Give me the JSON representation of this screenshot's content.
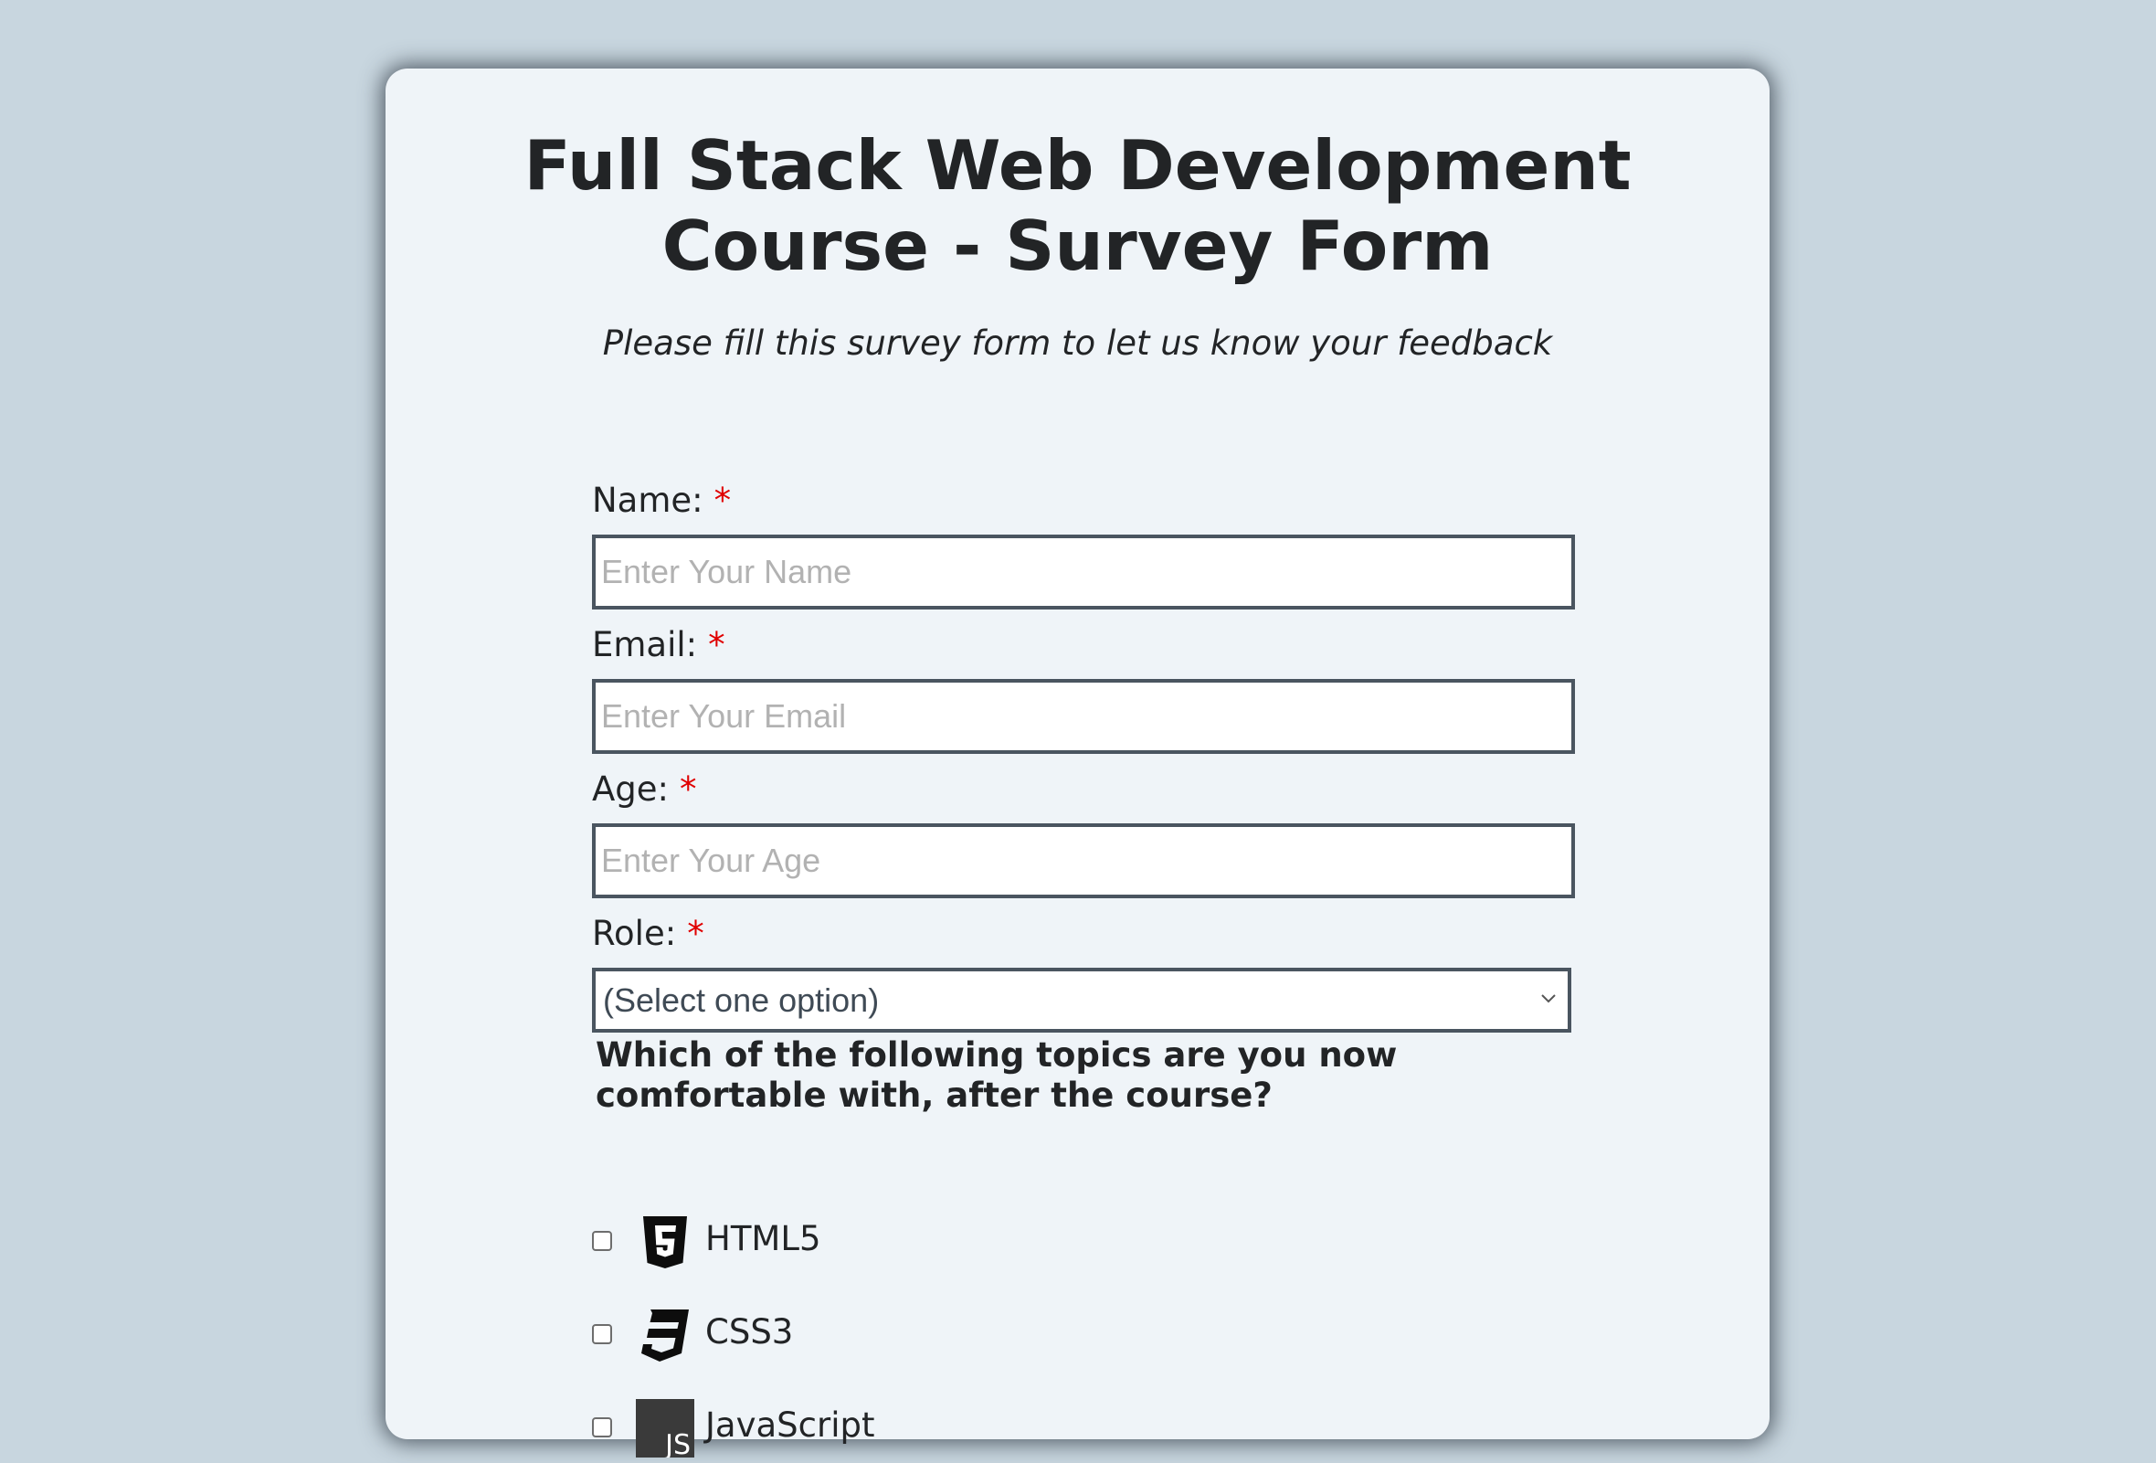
{
  "form": {
    "title": "Full Stack Web Development Course - Survey Form",
    "description": "Please fill this survey form to let us know your feedback",
    "required_marker": "*",
    "name": {
      "label": "Name:",
      "placeholder": "Enter Your Name"
    },
    "email": {
      "label": "Email:",
      "placeholder": "Enter Your Email"
    },
    "age": {
      "label": "Age:",
      "placeholder": "Enter Your Age"
    },
    "role": {
      "label": "Role:",
      "selected": "(Select one option)"
    },
    "topics_question": "Which of the following topics are you now comfortable with, after the course?",
    "topics": [
      {
        "label": "HTML5",
        "icon": "html5-icon",
        "checked": false
      },
      {
        "label": "CSS3",
        "icon": "css3-icon",
        "checked": false
      },
      {
        "label": "JavaScript",
        "icon": "javascript-icon",
        "icon_text": "JS",
        "checked": false
      }
    ]
  },
  "colors": {
    "page_background": "#c8d6df",
    "card_background": "#eff4f8",
    "required_marker": "#e00000",
    "input_border": "#4a5560"
  }
}
